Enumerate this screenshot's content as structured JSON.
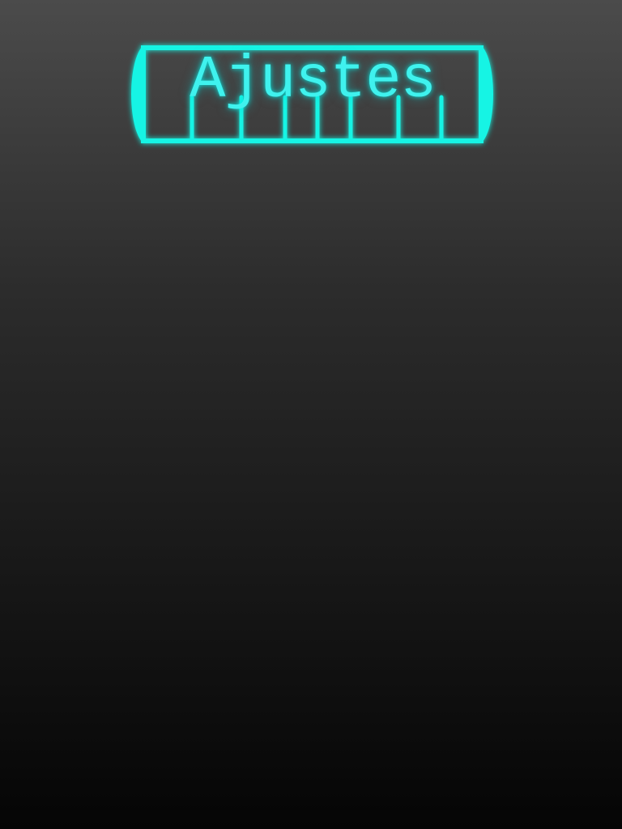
{
  "screen": {
    "name": "settings-screen"
  },
  "title_banner": {
    "label": "Ajustes",
    "accent_color": "#3ff2ee",
    "glow_color": "#00e6e6"
  }
}
